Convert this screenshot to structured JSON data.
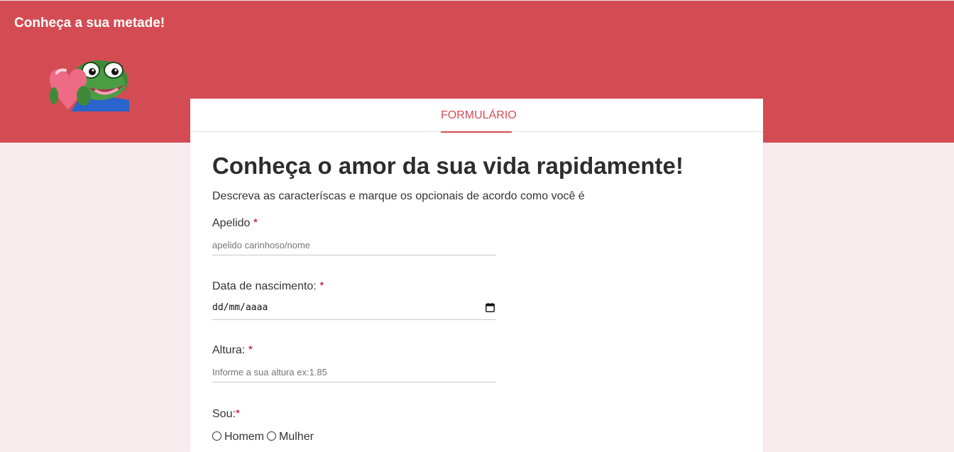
{
  "header": {
    "site_title": "Conheça a sua metade!",
    "background_color": "#d44c53",
    "mascot_icon": "frog-holding-heart-icon"
  },
  "tabs": [
    {
      "label": "FORMULÁRIO",
      "active": true
    }
  ],
  "form": {
    "title": "Conheça o amor da sua vida rapidamente!",
    "description": "Descreva as caracteríscas e marque os opcionais de acordo como você é",
    "required_marker": "*",
    "fields": {
      "nickname": {
        "label": "Apelido ",
        "placeholder": "apelido carinhoso/nome",
        "value": ""
      },
      "birthdate": {
        "label": "Data de nascimento: ",
        "display": "dd/mm/aaaa",
        "icon": "calendar-icon"
      },
      "height": {
        "label": "Altura: ",
        "placeholder": "Informe a sua altura ex:1.85",
        "value": ""
      },
      "gender": {
        "label": "Sou:",
        "options": [
          "Homem",
          "Mulher"
        ],
        "selected": null
      }
    }
  },
  "colors": {
    "accent": "#d44c53",
    "page_background": "#f8ecee",
    "required": "#c0002b"
  }
}
